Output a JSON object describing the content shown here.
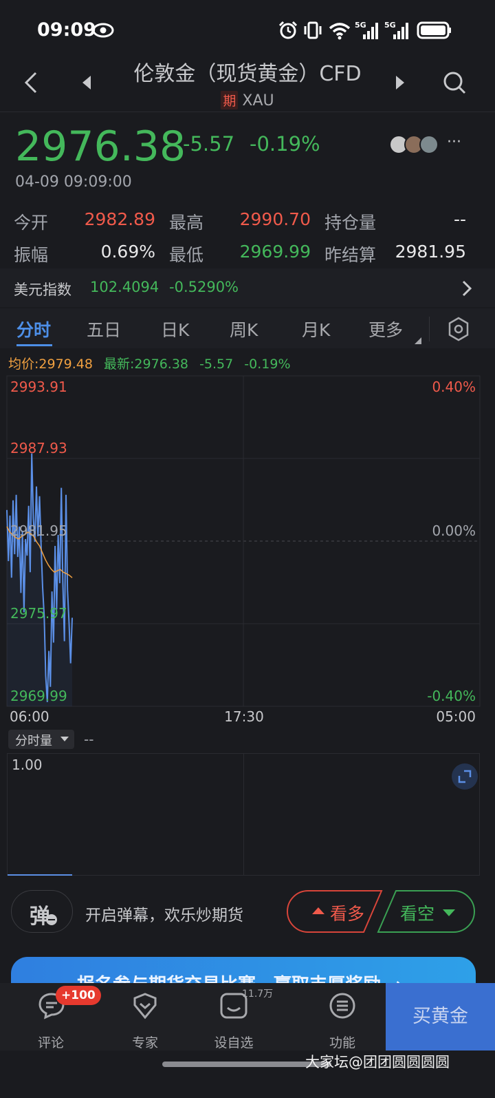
{
  "status_bar": {
    "time": "09:09",
    "net1": "5G",
    "net2": "5G"
  },
  "header": {
    "title": "伦敦金（现货黄金）CFD",
    "tag": "期",
    "symbol": "XAU"
  },
  "quote": {
    "price": "2976.38",
    "change": "-5.57",
    "change_pct": "-0.19%",
    "timestamp": "04-09 09:09:00"
  },
  "stats": {
    "open_label": "今开",
    "open": "2982.89",
    "high_label": "最高",
    "high": "2990.70",
    "oi_label": "持仓量",
    "oi": "--",
    "amp_label": "振幅",
    "amp": "0.69%",
    "low_label": "最低",
    "low": "2969.99",
    "prev_label": "昨结算",
    "prev": "2981.95"
  },
  "dxy": {
    "label": "美元指数",
    "value": "102.4094",
    "change_pct": "-0.5290%"
  },
  "tabs": [
    "分时",
    "五日",
    "日K",
    "周K",
    "月K",
    "更多"
  ],
  "legend": {
    "avg": "均价:2979.48",
    "latest": "最新:2976.38",
    "change": "-5.57",
    "change_pct": "-0.19%"
  },
  "chart_data": {
    "type": "line",
    "y_ticks_left": [
      "2993.91",
      "2987.93",
      "2981.95",
      "2975.97",
      "2969.99"
    ],
    "y_ticks_right": [
      "0.40%",
      "0.00%",
      "-0.40%"
    ],
    "x_ticks": [
      "06:00",
      "17:30",
      "05:00"
    ],
    "ylim": [
      2969.99,
      2993.91
    ],
    "reference_price": 2981.95,
    "series": [
      {
        "values": [
          2984.2,
          2980.5,
          2983.8,
          2979.3,
          2984.9,
          2981.0,
          2985.3,
          2980.8,
          2983.0,
          2978.2,
          2982.7,
          2976.8,
          2982.1,
          2980.9,
          2984.5,
          2979.7,
          2988.3,
          2983.6,
          2981.9,
          2985.9,
          2982.3,
          2985.2,
          2981.6,
          2978.6,
          2976.5,
          2972.2,
          2970.3,
          2974.0,
          2971.4,
          2978.3,
          2974.6,
          2981.6,
          2977.0,
          2982.4,
          2978.9,
          2985.8,
          2979.0,
          2974.7,
          2985.3,
          2978.4,
          2976.0,
          2973.1,
          2976.4
        ]
      },
      {
        "values": [
          2983.0,
          2982.6,
          2982.4,
          2982.2,
          2982.1,
          2982.3,
          2982.4,
          2982.6,
          2982.5,
          2982.3,
          2981.9,
          2981.6,
          2981.1,
          2980.6,
          2980.2,
          2979.9,
          2979.7,
          2979.8,
          2979.9,
          2979.7,
          2979.6,
          2979.48,
          2979.3
        ]
      }
    ]
  },
  "volume": {
    "selector": "分时量",
    "value": "--",
    "y_top": "1.00"
  },
  "danmaku": {
    "icon_text": "弹",
    "text": "开启弹幕，欢乐炒期货"
  },
  "buttons": {
    "bull": "看多",
    "bear": "看空"
  },
  "banner": {
    "text": "报名参与期货交易比赛，赢取丰厚奖励 →"
  },
  "nav": {
    "badge": "+100",
    "count": "11.7万",
    "items": [
      "评论",
      "专家",
      "设自选",
      "功能"
    ],
    "buy": "买黄金"
  },
  "watermark": "大家坛@团团圆圆圆圆",
  "colors": {
    "up": "#f05a4b",
    "down": "#44b85b",
    "accent": "#4d8fe8",
    "avg_line": "#f0a040",
    "price_line": "#5b8fe6"
  }
}
